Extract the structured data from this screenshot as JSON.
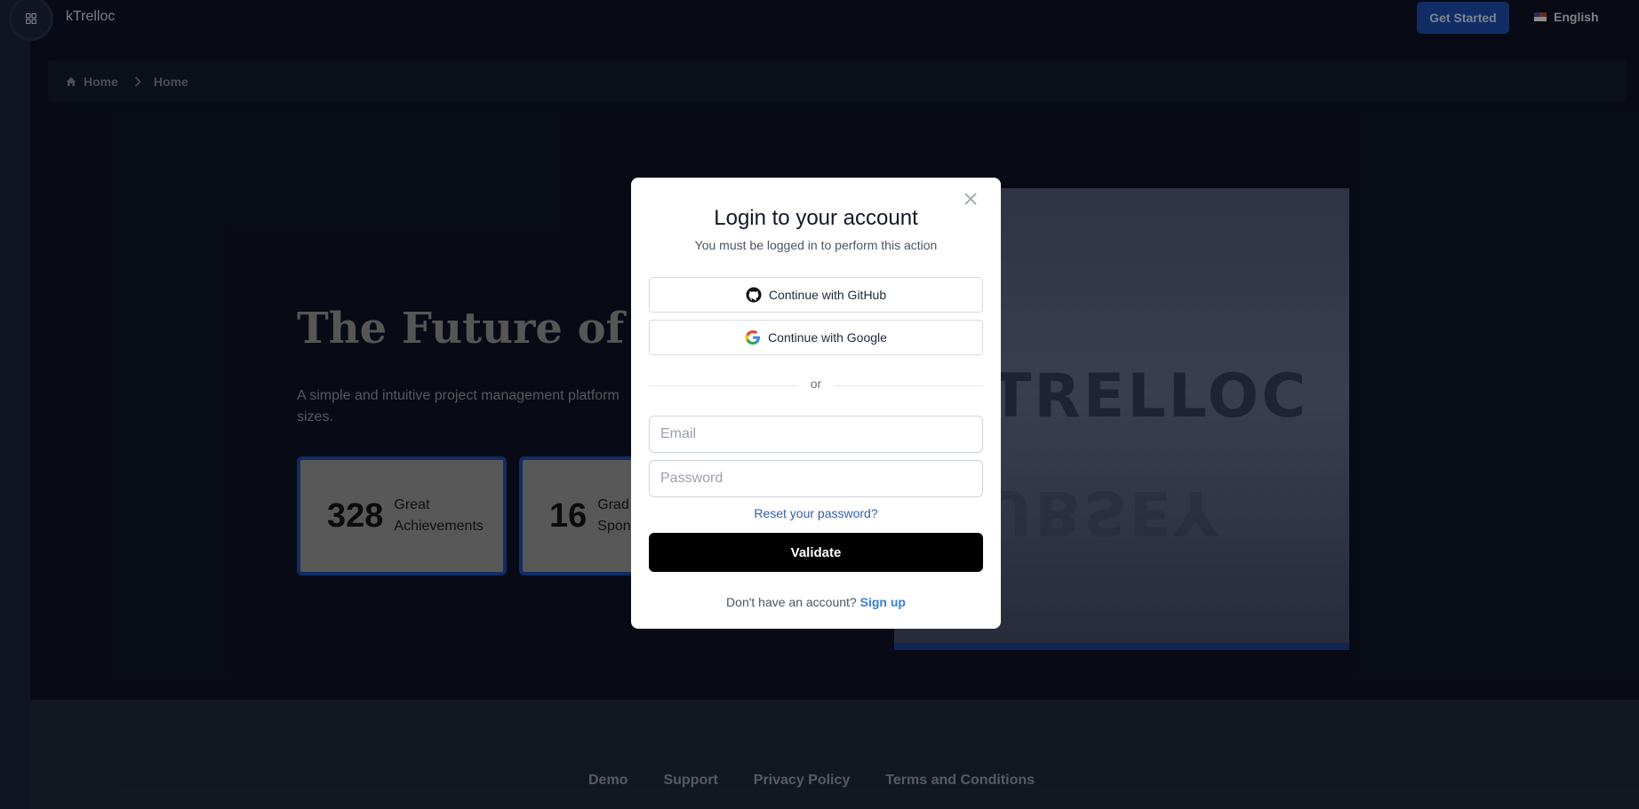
{
  "header": {
    "brand": "kTrelloc",
    "get_started": "Get Started",
    "language": "English"
  },
  "breadcrumb": {
    "items": [
      "Home",
      "Home"
    ]
  },
  "hero": {
    "title": "The Future of Tr",
    "subtitle_visible": "A simple and intuitive project management platform",
    "subtitle_wrap": "sizes.",
    "image_logo_text": "TRELLOC",
    "image_reflection_text": "UBSEY",
    "stats": [
      {
        "number": "328",
        "label_line1": "Great",
        "label_line2": "Achievements"
      },
      {
        "number": "16",
        "label_line1": "Grad",
        "label_line2": "Spon"
      }
    ]
  },
  "footer": {
    "links": [
      "Demo",
      "Support",
      "Privacy Policy",
      "Terms and Conditions"
    ]
  },
  "modal": {
    "title": "Login to your account",
    "subtitle": "You must be logged in to perform this action",
    "github_label": "Continue with GitHub",
    "google_label": "Continue with Google",
    "divider_text": "or",
    "email_placeholder": "Email",
    "password_placeholder": "Password",
    "reset_link": "Reset your password?",
    "validate_label": "Validate",
    "signup_prompt": "Don't have an account?",
    "signup_link": "Sign up"
  },
  "colors": {
    "accent": "#1e49a4",
    "link": "#3a7bd5",
    "background": "#0d1322"
  }
}
